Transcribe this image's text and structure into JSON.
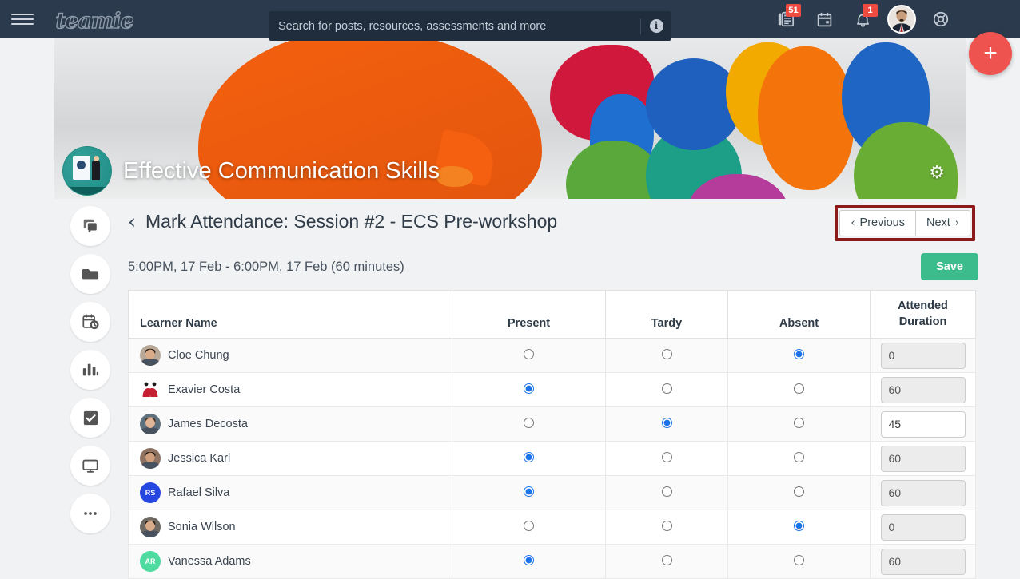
{
  "topnav": {
    "menu_icon": "hamburger-icon",
    "logo_text": "teamie",
    "search": {
      "placeholder": "Search for posts, resources, assessments and more",
      "value": "",
      "info_icon": "info-icon"
    },
    "icons": [
      {
        "name": "newsfeed-icon",
        "badge": "51"
      },
      {
        "name": "calendar-icon",
        "badge": ""
      },
      {
        "name": "notifications-bell-icon",
        "badge": "1"
      }
    ],
    "avatar": "user-avatar",
    "help_icon": "help-lifebuoy-icon",
    "fab_label": "+",
    "colors": {
      "bar": "#2b3a4d",
      "badge": "#ef4b41",
      "fab": "#ef5350"
    }
  },
  "banner": {
    "course_title": "Effective Communication Skills",
    "course_icon": "course-presentation-icon",
    "settings_icon": "gear-icon"
  },
  "sidebar": {
    "items": [
      {
        "name": "sidebar-item-discussions",
        "icon": "chat-bubble-icon",
        "active": false
      },
      {
        "name": "sidebar-item-materials",
        "icon": "folder-icon",
        "active": false
      },
      {
        "name": "sidebar-item-schedule",
        "icon": "calendar-clock-icon",
        "active": false
      },
      {
        "name": "sidebar-item-analytics",
        "icon": "bar-chart-icon",
        "active": false
      },
      {
        "name": "sidebar-item-attendance",
        "icon": "checkbox-check-icon",
        "active": true
      },
      {
        "name": "sidebar-item-classroom",
        "icon": "monitor-icon",
        "active": false
      },
      {
        "name": "sidebar-item-more",
        "icon": "ellipsis-icon",
        "active": false
      }
    ]
  },
  "main": {
    "back_icon": "chevron-left-icon",
    "page_title": "Mark Attendance: Session #2 - ECS Pre-workshop",
    "session_time": "5:00PM, 17 Feb - 6:00PM, 17 Feb (60 minutes)",
    "previous_label": "Previous",
    "next_label": "Next",
    "save_label": "Save",
    "highlight_color": "#8b1a1a",
    "save_color": "#3cbc8d",
    "columns": [
      "Learner Name",
      "Present",
      "Tardy",
      "Absent",
      "Attended Duration"
    ],
    "attended_duration_line1": "Attended",
    "attended_duration_line2": "Duration",
    "rows": [
      {
        "name": "Cloe Chung",
        "status": "absent",
        "duration": "0",
        "editable": false,
        "avatar_type": "photo",
        "avatar_initials": "",
        "avatar_color": "#b8a898"
      },
      {
        "name": "Exavier Costa",
        "status": "present",
        "duration": "60",
        "editable": false,
        "avatar_type": "logo",
        "avatar_initials": "",
        "avatar_color": "#c42032"
      },
      {
        "name": "James Decosta",
        "status": "tardy",
        "duration": "45",
        "editable": true,
        "avatar_type": "photo",
        "avatar_initials": "",
        "avatar_color": "#5e6f7d"
      },
      {
        "name": "Jessica Karl",
        "status": "present",
        "duration": "60",
        "editable": false,
        "avatar_type": "photo",
        "avatar_initials": "",
        "avatar_color": "#8d7261"
      },
      {
        "name": "Rafael Silva",
        "status": "present",
        "duration": "60",
        "editable": false,
        "avatar_type": "initial",
        "avatar_initials": "RS",
        "avatar_color": "#2547e0"
      },
      {
        "name": "Sonia Wilson",
        "status": "absent",
        "duration": "0",
        "editable": false,
        "avatar_type": "photo",
        "avatar_initials": "",
        "avatar_color": "#6e6a63"
      },
      {
        "name": "Vanessa Adams",
        "status": "present",
        "duration": "60",
        "editable": false,
        "avatar_type": "initial",
        "avatar_initials": "AR",
        "avatar_color": "#4ddba0"
      }
    ]
  }
}
